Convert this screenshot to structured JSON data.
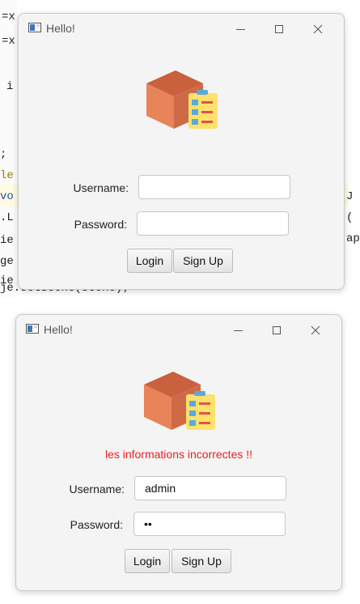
{
  "windows": [
    {
      "title": "Hello!",
      "error_message": "",
      "username_label": "Username:",
      "password_label": "Password:",
      "username_value": "",
      "password_value": "",
      "login_label": "Login",
      "signup_label": "Sign Up"
    },
    {
      "title": "Hello!",
      "error_message": "les informations incorrectes !!",
      "username_label": "Username:",
      "password_label": "Password:",
      "username_value": "admin",
      "password_value": "••",
      "login_label": "Login",
      "signup_label": "Sign Up"
    }
  ],
  "background_code": {
    "line_1": "=x",
    "line_2": "=x",
    "line_3": "i",
    "line_4": ";",
    "line_5": "le",
    "line_6": "vo",
    "line_7": ".L",
    "line_8": "ie",
    "line_9": "ge",
    "line_10": "ie",
    "line_11": "je.setScene(scene);",
    "right_1": "J",
    "right_2": "(",
    "right_3": "ap"
  },
  "colors": {
    "error_text": "#e02424",
    "window_bg": "#f4f4f4",
    "box_front": "#e8845a",
    "box_top": "#c9603e",
    "clipboard": "#ffe26b",
    "check_blue": "#5aa9dc",
    "dash_red": "#e2524a"
  },
  "icons": {
    "app": "window-app-icon",
    "logo": "package-checklist-icon"
  }
}
